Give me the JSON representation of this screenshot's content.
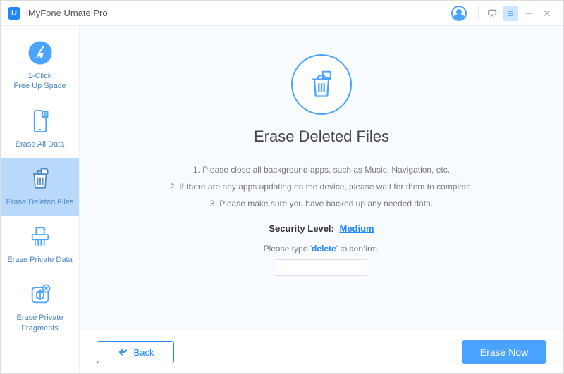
{
  "window": {
    "title": "iMyFone Umate Pro",
    "logo_letter": "U"
  },
  "sidebar": {
    "items": [
      {
        "label": "1-Click\nFree Up Space",
        "active": false
      },
      {
        "label": "Erase All Data",
        "active": false
      },
      {
        "label": "Erase Deleted Files",
        "active": true
      },
      {
        "label": "Erase Private Data",
        "active": false
      },
      {
        "label": "Erase Private\nFragments",
        "active": false
      }
    ]
  },
  "main": {
    "heading": "Erase Deleted Files",
    "instructions": {
      "line1": "1. Please close all background apps, such as Music, Navigation, etc.",
      "line2": "2. If there are any apps updating on the device, please wait for them to complete.",
      "line3": "3. Please make sure you have backed up any needed data."
    },
    "security_label": "Security Level:",
    "security_value": "Medium",
    "confirm_prefix": "Please type '",
    "confirm_keyword": "delete",
    "confirm_suffix": "' to confirm.",
    "confirm_value": ""
  },
  "buttons": {
    "back": "Back",
    "erase": "Erase Now"
  },
  "colors": {
    "accent": "#1e88ff",
    "sidebar_active": "#b9d9fb",
    "content_bg": "#f8fbff"
  }
}
